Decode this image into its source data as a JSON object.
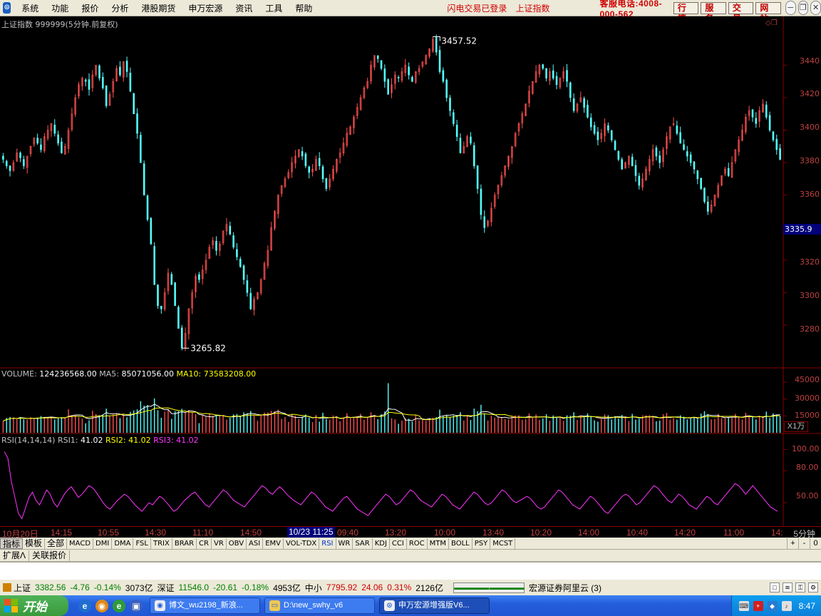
{
  "menubar": {
    "items": [
      "系统",
      "功能",
      "报价",
      "分析",
      "港股期货",
      "申万宏源",
      "资讯",
      "工具",
      "帮助"
    ],
    "login_status": "闪电交易已登录",
    "index_link": "上证指数",
    "hotline": "客服电话:4008-000-562",
    "buttons": [
      "行 情",
      "服 务",
      "交 易",
      "网 站"
    ]
  },
  "ticker_header": {
    "name": "上证指数",
    "code": "999999",
    "period": "(5分钟.前复权)"
  },
  "price_axis": {
    "ticks": [
      "3440",
      "3420",
      "3400",
      "3380",
      "3360",
      "3320",
      "3300",
      "3280"
    ],
    "current": "3335.9"
  },
  "annotations": {
    "high": "3457.52",
    "low": "3265.82"
  },
  "volume_header": {
    "label": "VOLUME:",
    "value": "124236568.00",
    "ma5_label": "MA5:",
    "ma5": "85071056.00",
    "ma10_label": "MA10:",
    "ma10": "73583208.00"
  },
  "volume_axis": {
    "ticks": [
      "45000",
      "30000",
      "15000"
    ],
    "unit": "X1万"
  },
  "rsi_header": {
    "label": "RSI(14,14,14)",
    "rsi1_label": "RSI1:",
    "rsi1": "41.02",
    "rsi2_label": "RSI2:",
    "rsi2": "41.02",
    "rsi3_label": "RSI3:",
    "rsi3": "41.02"
  },
  "rsi_axis": {
    "ticks": [
      "100.00",
      "80.00",
      "50.00"
    ]
  },
  "time_axis": {
    "labels": [
      "10月20日",
      "14:15",
      "10:55",
      "14:30",
      "11:10",
      "14:50",
      "09:40",
      "13:20",
      "10:00",
      "13:40",
      "10:20",
      "14:00",
      "10:40",
      "14:20",
      "11:00",
      "14:"
    ],
    "cursor": "10/23 11:25",
    "period": "5分钟"
  },
  "indicator_tabs": [
    "指标",
    "模板",
    "全部",
    "MACD",
    "DMI",
    "DMA",
    "FSL",
    "TRIX",
    "BRAR",
    "CR",
    "VR",
    "OBV",
    "ASI",
    "EMV",
    "VOL-TDX",
    "RSI",
    "WR",
    "SAR",
    "KDJ",
    "CCI",
    "ROC",
    "MTM",
    "BOLL",
    "PSY",
    "MCST"
  ],
  "indicator_controls": [
    "+",
    "-",
    "0"
  ],
  "ext_tabs": [
    "扩展Λ",
    "关联报价"
  ],
  "statusbar": {
    "sh": {
      "name": "上证",
      "price": "3382.56",
      "chg": "-4.76",
      "pct": "-0.14%",
      "amt": "3073亿"
    },
    "sz": {
      "name": "深证",
      "price": "11546.0",
      "chg": "-20.61",
      "pct": "-0.18%",
      "amt": "4953亿"
    },
    "zx": {
      "name": "中小",
      "price": "7795.92",
      "chg": "24.06",
      "pct": "0.31%",
      "amt": "2126亿"
    },
    "server": "宏源证券阿里云 (3)"
  },
  "taskbar": {
    "start": "开始",
    "tasks": [
      "博文_wu2198_新浪...",
      "D:\\new_swhy_v6",
      "申万宏源增强版V6..."
    ],
    "clock": "8:47"
  },
  "colors": {
    "up": "#ff5050",
    "down": "#54ffff",
    "frame": "#8a0000",
    "rsi": "#ff33ff",
    "ma5": "#ffffff",
    "ma10": "#ffff00"
  },
  "chart_data": {
    "type": "candlestick",
    "title": "上证指数 999999(5分钟.前复权)",
    "ylim": [
      3255,
      3470
    ],
    "close_series": [
      3382,
      3378,
      3375,
      3380,
      3386,
      3383,
      3378,
      3384,
      3390,
      3395,
      3392,
      3388,
      3396,
      3400,
      3404,
      3398,
      3392,
      3386,
      3390,
      3400,
      3410,
      3420,
      3428,
      3432,
      3430,
      3425,
      3434,
      3440,
      3432,
      3426,
      3415,
      3422,
      3430,
      3438,
      3434,
      3442,
      3436,
      3424,
      3410,
      3398,
      3380,
      3360,
      3345,
      3330,
      3305,
      3292,
      3290,
      3300,
      3312,
      3305,
      3292,
      3278,
      3266,
      3275,
      3290,
      3300,
      3310,
      3308,
      3314,
      3320,
      3328,
      3332,
      3326,
      3330,
      3338,
      3342,
      3336,
      3328,
      3322,
      3316,
      3308,
      3300,
      3290,
      3296,
      3300,
      3308,
      3318,
      3326,
      3340,
      3350,
      3360,
      3366,
      3370,
      3374,
      3380,
      3384,
      3388,
      3384,
      3378,
      3374,
      3376,
      3382,
      3378,
      3370,
      3364,
      3370,
      3376,
      3382,
      3386,
      3392,
      3398,
      3402,
      3408,
      3414,
      3420,
      3426,
      3430,
      3440,
      3446,
      3444,
      3438,
      3430,
      3422,
      3428,
      3434,
      3432,
      3436,
      3440,
      3434,
      3430,
      3436,
      3438,
      3442,
      3446,
      3450,
      3456,
      3448,
      3436,
      3430,
      3420,
      3412,
      3404,
      3396,
      3386,
      3390,
      3396,
      3392,
      3378,
      3364,
      3348,
      3340,
      3344,
      3352,
      3360,
      3366,
      3372,
      3378,
      3384,
      3390,
      3398,
      3404,
      3410,
      3416,
      3424,
      3430,
      3436,
      3440,
      3438,
      3432,
      3436,
      3432,
      3428,
      3432,
      3436,
      3430,
      3420,
      3412,
      3416,
      3420,
      3414,
      3408,
      3402,
      3398,
      3394,
      3398,
      3404,
      3400,
      3394,
      3388,
      3382,
      3376,
      3380,
      3384,
      3378,
      3372,
      3366,
      3370,
      3376,
      3382,
      3388,
      3384,
      3380,
      3388,
      3396,
      3402,
      3404,
      3398,
      3392,
      3388,
      3384,
      3380,
      3376,
      3370,
      3364,
      3356,
      3350,
      3354,
      3360,
      3366,
      3372,
      3376,
      3372,
      3380,
      3388,
      3394,
      3400,
      3408,
      3412,
      3408,
      3404,
      3412,
      3416,
      3408,
      3400,
      3394,
      3388,
      3382
    ],
    "high": {
      "value": 3457.52
    },
    "low": {
      "value": 3265.82
    },
    "volume_ylim": [
      0,
      50000
    ],
    "volume_ma": {
      "ma5": 85071056,
      "ma10": 73583208
    },
    "rsi": {
      "ylim": [
        30,
        105
      ],
      "values": [
        98,
        92,
        70,
        55,
        40,
        35,
        45,
        55,
        60,
        52,
        48,
        55,
        62,
        58,
        50,
        46,
        52,
        58,
        62,
        65,
        60,
        55,
        58,
        62,
        66,
        64,
        60,
        55,
        50,
        46,
        44,
        48,
        52,
        55,
        58,
        56,
        52,
        48,
        45,
        42,
        46,
        50,
        48,
        52,
        56,
        54,
        50,
        46,
        42,
        44,
        48,
        52,
        55,
        58,
        60,
        56,
        52,
        48,
        46,
        50,
        54,
        58,
        62,
        60,
        56,
        52,
        50,
        48,
        46,
        50,
        54,
        58,
        62,
        66,
        64,
        60,
        58,
        62,
        65,
        62,
        58,
        55,
        52,
        50,
        48,
        52,
        56,
        60,
        58,
        54,
        50,
        46,
        44,
        42,
        46,
        50,
        54,
        56,
        52,
        48,
        44,
        42,
        40,
        38,
        42,
        46,
        50,
        54,
        58,
        56,
        52,
        48,
        50,
        54,
        58,
        62,
        60,
        56,
        52,
        50,
        48,
        46,
        50,
        54,
        58,
        56,
        52,
        48,
        46,
        44,
        48,
        52,
        56,
        60,
        58,
        54,
        50,
        48,
        50,
        54,
        58,
        62,
        60,
        56,
        52,
        50,
        52,
        54,
        56,
        54,
        50,
        46,
        44,
        46,
        50,
        54,
        58,
        62,
        60,
        56,
        52,
        48,
        46,
        44,
        48,
        52,
        56,
        54,
        50,
        46,
        42,
        40,
        44,
        48,
        52,
        56,
        58,
        56,
        52,
        48,
        50,
        54,
        58,
        62,
        66,
        64,
        60,
        56,
        52,
        50,
        54,
        58,
        56,
        52,
        48,
        46,
        44,
        48,
        52,
        56,
        54,
        50,
        48,
        52,
        56,
        60,
        64,
        68,
        66,
        62,
        58,
        62,
        66,
        62,
        58,
        54,
        50,
        46,
        44,
        42
      ]
    }
  }
}
